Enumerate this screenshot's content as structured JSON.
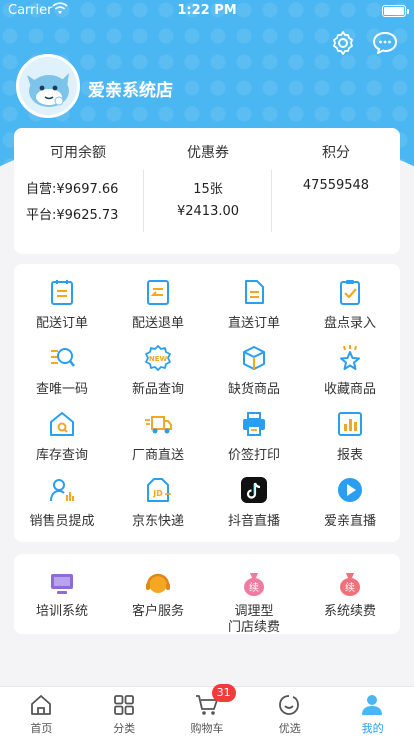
{
  "status_bar": {
    "carrier": "Carrier",
    "time": "1:22 PM"
  },
  "store": {
    "name": "爱亲系统店"
  },
  "balance": {
    "available": {
      "title": "可用余额",
      "self_run": "自营:¥9697.66",
      "platform": "平台:¥9625.73"
    },
    "coupon": {
      "title": "优惠券",
      "count": "15张",
      "amount": "¥2413.00"
    },
    "points": {
      "title": "积分",
      "value": "47559548"
    }
  },
  "menu": [
    {
      "label": "配送订单",
      "icon": "order-icon"
    },
    {
      "label": "配送退单",
      "icon": "return-icon"
    },
    {
      "label": "直送订单",
      "icon": "document-icon"
    },
    {
      "label": "盘点录入",
      "icon": "clipboard-check-icon"
    },
    {
      "label": "查唯一码",
      "icon": "search-code-icon"
    },
    {
      "label": "新品查询",
      "icon": "new-badge-icon"
    },
    {
      "label": "缺货商品",
      "icon": "box-icon"
    },
    {
      "label": "收藏商品",
      "icon": "star-icon"
    },
    {
      "label": "库存查询",
      "icon": "warehouse-icon"
    },
    {
      "label": "厂商直送",
      "icon": "truck-icon"
    },
    {
      "label": "价签打印",
      "icon": "printer-icon"
    },
    {
      "label": "报表",
      "icon": "chart-icon"
    },
    {
      "label": "销售员提成",
      "icon": "salesman-icon"
    },
    {
      "label": "京东快递",
      "icon": "jd-express-icon"
    },
    {
      "label": "抖音直播",
      "icon": "tiktok-icon"
    },
    {
      "label": "爱亲直播",
      "icon": "play-icon"
    }
  ],
  "services": [
    {
      "label": "培训系统",
      "icon": "monitor-icon"
    },
    {
      "label": "客户服务",
      "icon": "headset-icon"
    },
    {
      "label": "调理型",
      "label2": "门店续费",
      "icon": "renew-bag-icon"
    },
    {
      "label": "系统续费",
      "icon": "renew-bag-icon"
    }
  ],
  "tabs": [
    {
      "label": "首页",
      "icon": "home-icon"
    },
    {
      "label": "分类",
      "icon": "grid-icon"
    },
    {
      "label": "购物车",
      "icon": "cart-icon",
      "badge": "31"
    },
    {
      "label": "优选",
      "icon": "smile-icon"
    },
    {
      "label": "我的",
      "icon": "person-icon",
      "active": true
    }
  ],
  "colors": {
    "primary": "#4ab6f2",
    "accent": "#2a9ef0",
    "badge": "#f23b3b",
    "orange": "#f5a623"
  }
}
